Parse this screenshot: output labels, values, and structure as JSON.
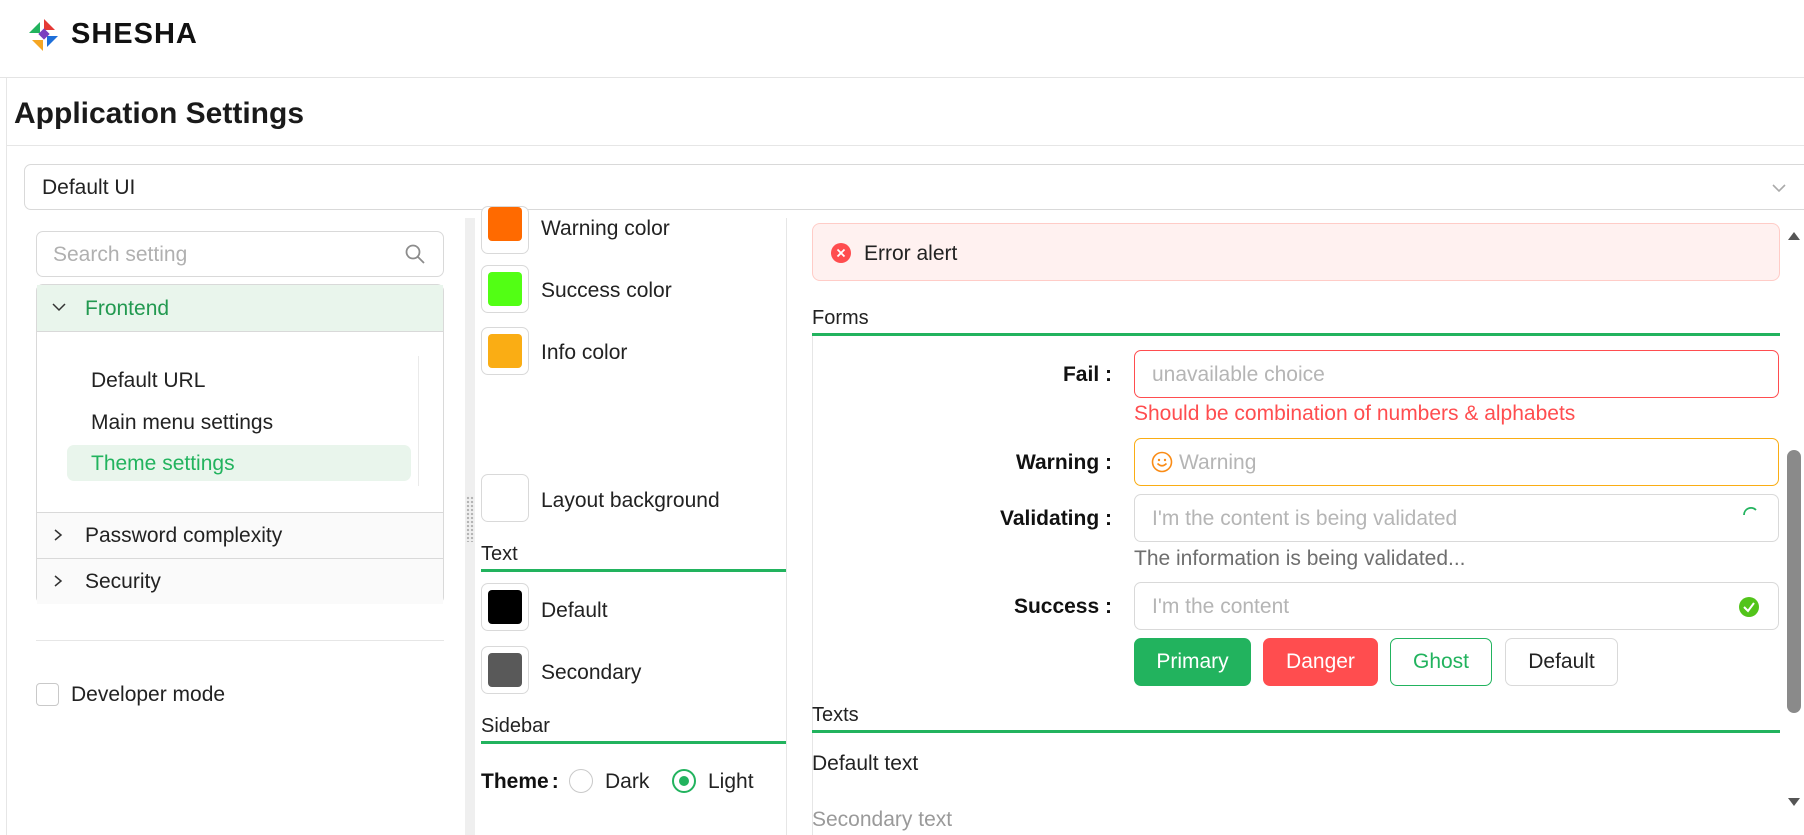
{
  "brand": {
    "name": "SHESHA",
    "logo_icon": "shesha-logo-icon"
  },
  "page": {
    "title": "Application Settings"
  },
  "ui_selector": {
    "value": "Default UI",
    "icon": "chevron-down-icon"
  },
  "left_panel": {
    "search": {
      "placeholder": "Search setting",
      "icon": "search-icon"
    },
    "groups": [
      {
        "label": "Frontend",
        "expanded": true,
        "items": [
          {
            "label": "Default URL",
            "active": false
          },
          {
            "label": "Main menu settings",
            "active": false
          },
          {
            "label": "Theme settings",
            "active": true
          }
        ]
      },
      {
        "label": "Password complexity",
        "expanded": false
      },
      {
        "label": "Security",
        "expanded": false
      }
    ],
    "developer_mode": {
      "label": "Developer mode",
      "checked": false
    }
  },
  "theme": {
    "colors": [
      {
        "label": "Warning color",
        "color": "#ff6a00"
      },
      {
        "label": "Success color",
        "color": "#52ff14"
      },
      {
        "label": "Info color",
        "color": "#faad14"
      },
      {
        "label": "Layout background",
        "color": "#ffffff"
      }
    ],
    "text_section": {
      "title": "Text",
      "items": [
        {
          "label": "Default",
          "color": "#000000"
        },
        {
          "label": "Secondary",
          "color": "#595959"
        }
      ]
    },
    "sidebar_section": {
      "title": "Sidebar",
      "theme_label": "Theme",
      "options": [
        {
          "label": "Dark",
          "selected": false
        },
        {
          "label": "Light",
          "selected": true
        }
      ]
    }
  },
  "preview": {
    "alert": {
      "text": "Error alert",
      "icon": "close-circle-icon"
    },
    "forms": {
      "title": "Forms",
      "fail": {
        "label": "Fail",
        "placeholder": "unavailable choice",
        "help": "Should be combination of numbers & alphabets"
      },
      "warning": {
        "label": "Warning",
        "placeholder": "Warning",
        "icon": "smile-icon"
      },
      "validating": {
        "label": "Validating",
        "placeholder": "I'm the content is being validated",
        "help": "The information is being validated...",
        "icon": "loading-icon"
      },
      "success": {
        "label": "Success",
        "placeholder": "I'm the content",
        "icon": "check-circle-icon"
      },
      "buttons": {
        "primary": "Primary",
        "danger": "Danger",
        "ghost": "Ghost",
        "default": "Default"
      }
    },
    "texts": {
      "title": "Texts",
      "default": "Default text",
      "secondary": "Secondary text"
    }
  },
  "colors": {
    "accent": "#22b35e",
    "danger": "#ff4d4f",
    "warning": "#faad14",
    "alert_bg": "#fff1f0"
  }
}
